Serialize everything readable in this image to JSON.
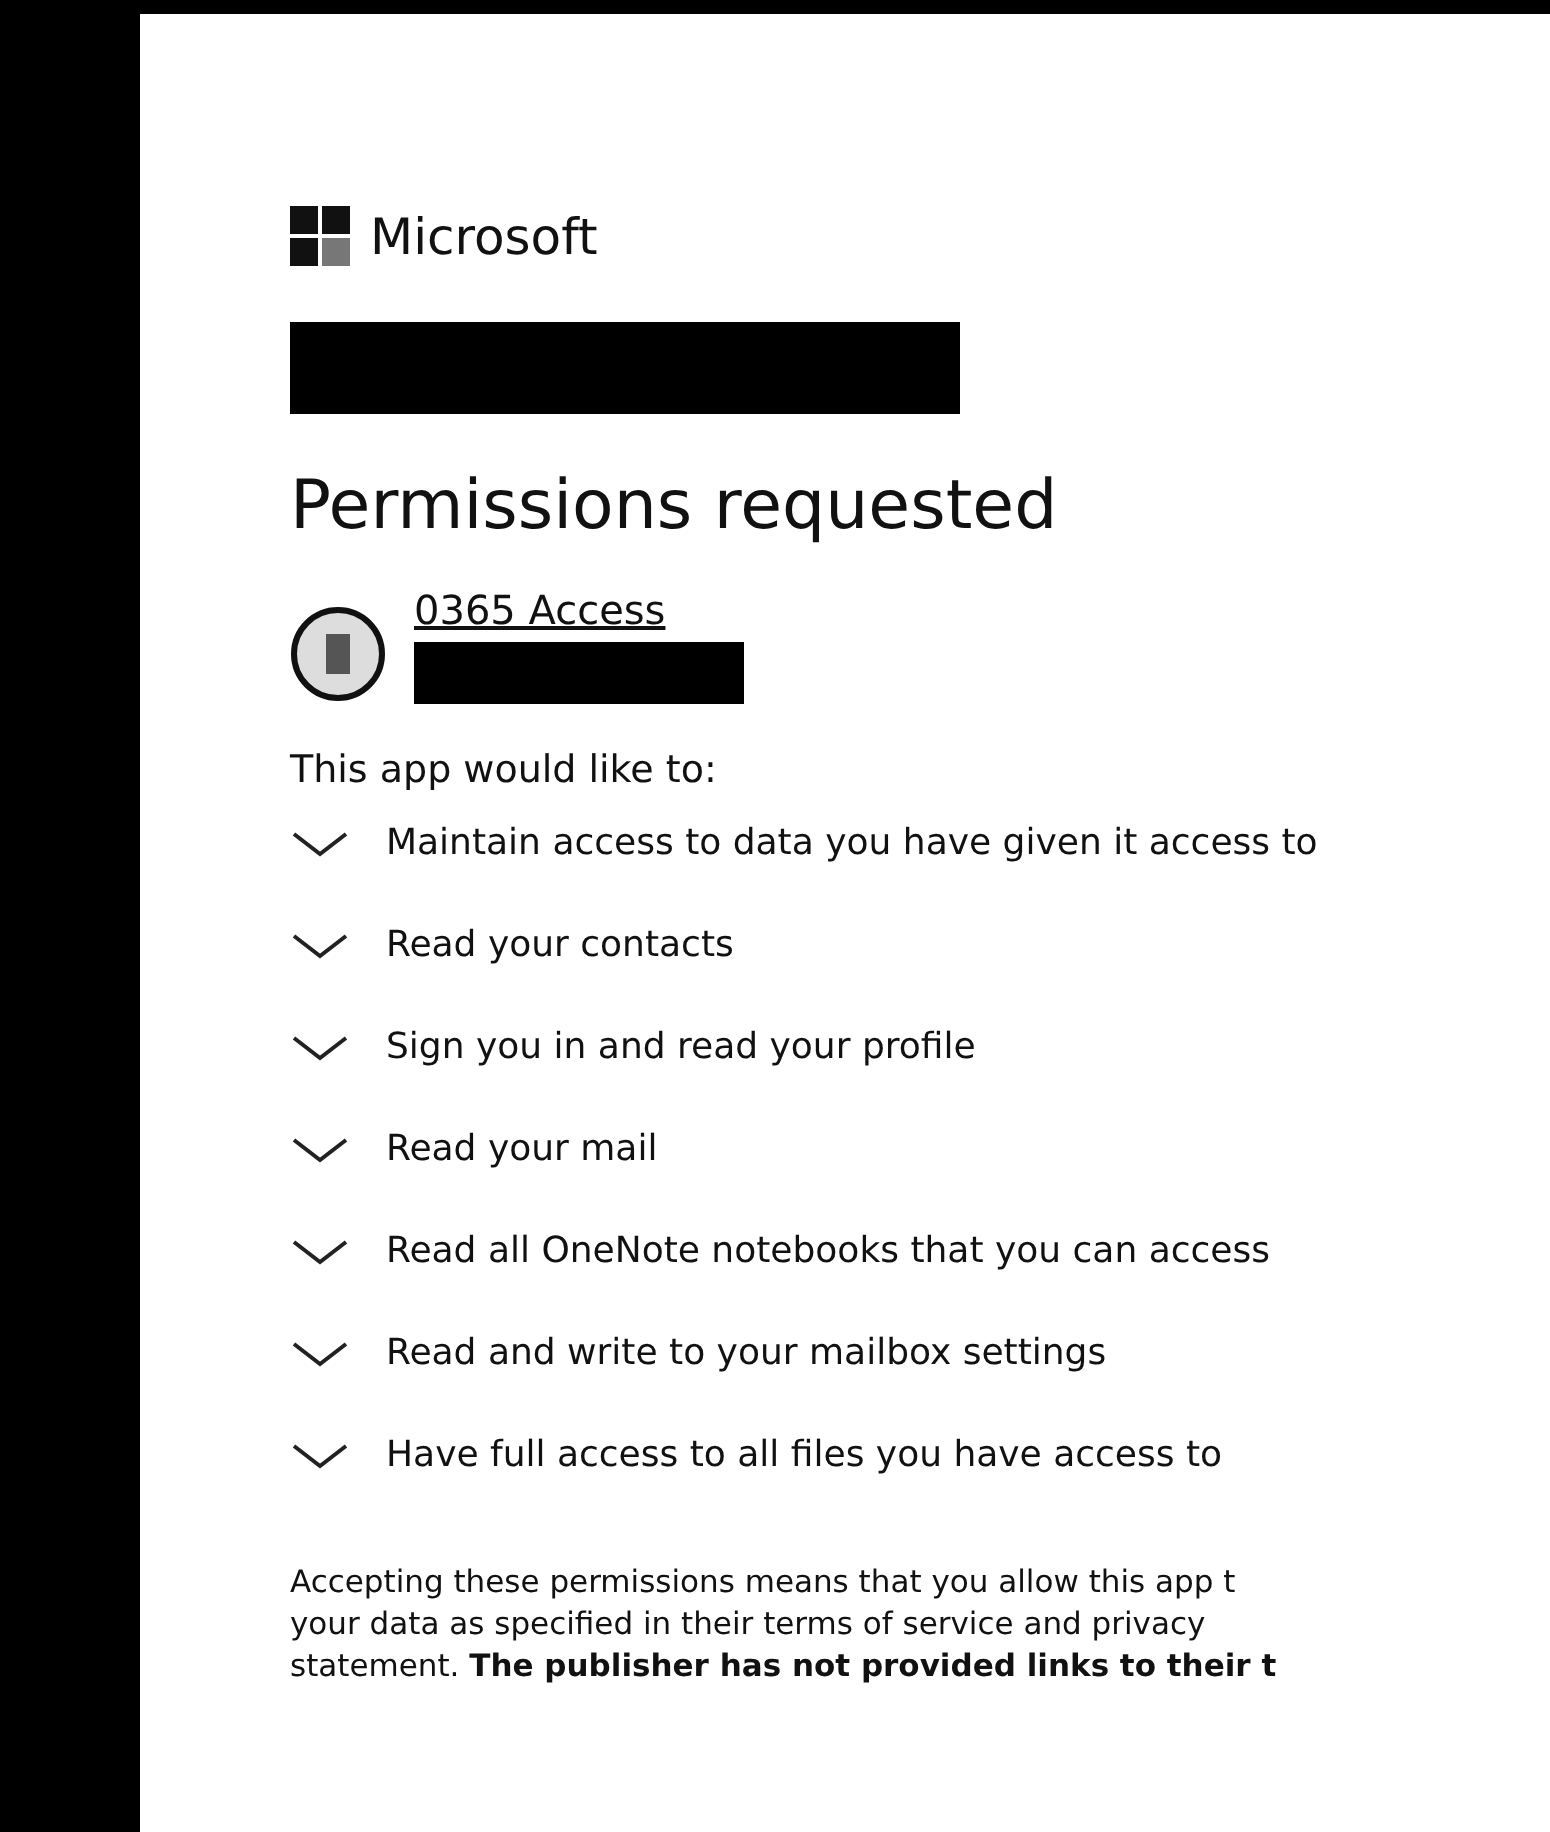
{
  "brand": {
    "name": "Microsoft"
  },
  "title": "Permissions requested",
  "app": {
    "name": "0365 Access"
  },
  "intro": "This app would like to:",
  "permissions": [
    {
      "label": "Maintain access to data you have given it access to",
      "expanded": false
    },
    {
      "label": "Read your contacts",
      "expanded": false
    },
    {
      "label": "Sign you in and read your profile",
      "expanded": false
    },
    {
      "label": "Read your mail",
      "expanded": false
    },
    {
      "label": "Read all OneNote notebooks that you can access",
      "expanded": false
    },
    {
      "label": "Read and write to your mailbox settings",
      "expanded": false
    },
    {
      "label": "Have full access to all files you have access to",
      "expanded": false
    }
  ],
  "notice_lines": [
    "Accepting these permissions means that you allow this app t",
    "your data as specified in their terms of service and privacy",
    "statement. **The publisher has not provided links to their t**"
  ]
}
